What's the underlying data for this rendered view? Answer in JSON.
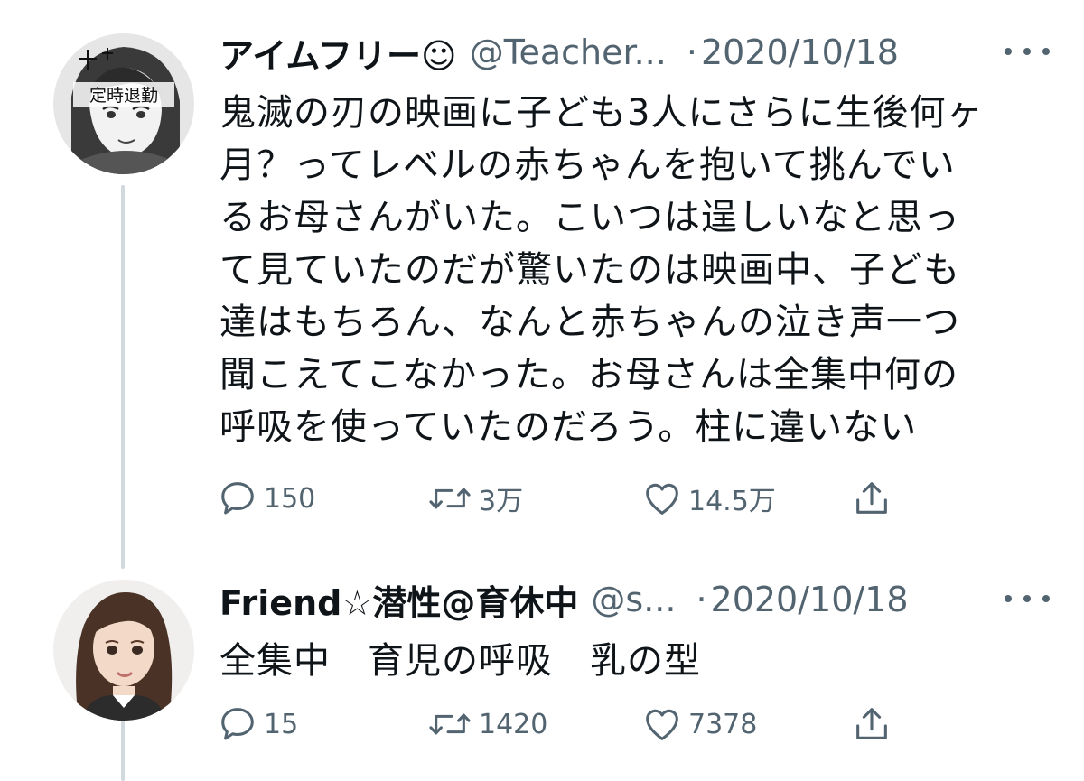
{
  "tweets": [
    {
      "display_name": "アイムフリー☺︎",
      "handle": "@Teacher...",
      "separator": "·",
      "date": "2020/10/18",
      "avatar_text": "定時退勤",
      "text": "鬼滅の刃の映画に子ども3人にさらに生後何ヶ\n月？ってレベルの赤ちゃんを抱いて挑んでい\nるお母さんがいた。こいつは逞しいなと思っ\nて見ていたのだが驚いたのは映画中、子ども\n達はもちろん、なんと赤ちゃんの泣き声一つ\n聞こえてこなかった。お母さんは全集中何の\n呼吸を使っていたのだろう。柱に違いない",
      "replies": "150",
      "retweets": "3万",
      "likes": "14.5万"
    },
    {
      "display_name": "Friend☆潜性@育休中",
      "handle": "@s...",
      "separator": "·",
      "date": "2020/10/18",
      "text": "全集中　育児の呼吸　乳の型",
      "replies": "15",
      "retweets": "1420",
      "likes": "7378"
    }
  ],
  "icons": {
    "reply": "speech-bubble-icon",
    "retweet": "retweet-arrows-icon",
    "like": "heart-icon",
    "share": "share-upload-icon",
    "more": "three-dots-icon"
  },
  "colors": {
    "text": "#0f1419",
    "secondary": "#536471",
    "thread_line": "#cfd9de"
  }
}
